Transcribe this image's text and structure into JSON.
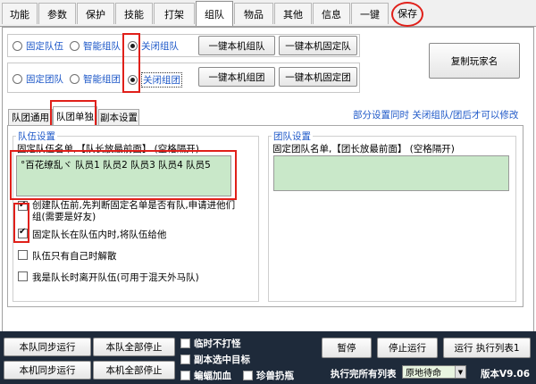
{
  "tabs": [
    "功能",
    "参数",
    "保护",
    "技能",
    "打架",
    "组队",
    "物品",
    "其他",
    "信息",
    "一键",
    "保存"
  ],
  "active_tab_index": 5,
  "team_row": {
    "options": [
      "固定队伍",
      "智能组队",
      "关闭组队"
    ],
    "selected": 2,
    "btn1": "一键本机组队",
    "btn2": "一键本机固定队"
  },
  "group_row": {
    "options": [
      "固定团队",
      "智能组团",
      "关闭组团"
    ],
    "selected": 2,
    "btn1": "一键本机组团",
    "btn2": "一键本机固定团"
  },
  "copy_name_button": "复制玩家名",
  "subtabs": [
    "队团通用",
    "队团单独",
    "副本设置"
  ],
  "active_subtab_index": 1,
  "notice": "部分设置同时 关闭组队/团后才可以修改",
  "team_settings": {
    "legend": "队伍设置",
    "list_label": "固定队伍名单,【队长放最前面】 (空格隔开)",
    "list_value": "°百花缭乱ヾ 队员1 队员2 队员3 队员4 队员5",
    "options": [
      {
        "label": "创建队伍前,先判断固定名单是否有队,申请进他们组(需要是好友)",
        "checked": true
      },
      {
        "label": "固定队长在队伍内时,将队伍给他",
        "checked": true
      },
      {
        "label": "队伍只有自己时解散",
        "checked": false
      },
      {
        "label": "我是队长时离开队伍(可用于混天外马队)",
        "checked": false
      }
    ]
  },
  "group_settings": {
    "legend": "团队设置",
    "list_label": "固定团队名单,【团长放最前面】 (空格隔开)",
    "list_value": ""
  },
  "bottom": {
    "btn_team_sync": "本队同步运行",
    "btn_team_stop": "本队全部停止",
    "btn_local_sync": "本机同步运行",
    "btn_local_stop": "本机全部停止",
    "chk_no_fight": "临时不打怪",
    "chk_selected_target": "副本选中目标",
    "chk_bat_speed": "蝙蝠加血",
    "chk_rare_beast": "珍兽扔瓶",
    "btn_pause": "暂停",
    "btn_stop": "停止运行",
    "btn_run": "运行 执行列表1",
    "after_label": "执行完所有列表",
    "after_select": "原地待命",
    "version": "版本V9.06"
  }
}
